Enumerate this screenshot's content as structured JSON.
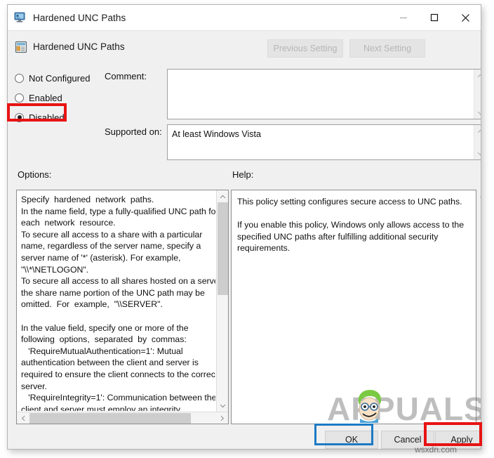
{
  "window": {
    "title": "Hardened UNC Paths",
    "title_icon": "monitor-icon",
    "minimize_label": "—",
    "maximize_label": "□",
    "close_label": "✕"
  },
  "header": {
    "icon": "policy-setting-icon",
    "title": "Hardened UNC Paths",
    "previous_setting_label": "Previous Setting",
    "next_setting_label": "Next Setting"
  },
  "state": {
    "options": [
      {
        "label": "Not Configured",
        "selected": false
      },
      {
        "label": "Enabled",
        "selected": false
      },
      {
        "label": "Disabled",
        "selected": true
      }
    ],
    "selected_value": "Disabled"
  },
  "comment": {
    "label": "Comment:",
    "value": ""
  },
  "supported_on": {
    "label": "Supported on:",
    "value": "At least Windows Vista"
  },
  "options_panel": {
    "label": "Options:",
    "text": "Specify  hardened  network  paths.\nIn the name field, type a fully-qualified UNC path for\neach  network  resource.\nTo secure all access to a share with a particular\nname, regardless of the server name, specify a\nserver name of '*' (asterisk). For example,\n\"\\\\*\\NETLOGON\".\nTo secure all access to all shares hosted on a server,\nthe share name portion of the UNC path may be\nomitted.  For  example,  \"\\\\SERVER\".\n\nIn the value field, specify one or more of the\nfollowing  options,  separated  by  commas:\n   'RequireMutualAuthentication=1': Mutual\nauthentication between the client and server is\nrequired to ensure the client connects to the correct\nserver.\n   'RequireIntegrity=1': Communication between the\nclient and server must employ an integrity"
  },
  "help_panel": {
    "label": "Help:",
    "text": "This policy setting configures secure access to UNC paths.\n\nIf you enable this policy, Windows only allows access to the specified UNC paths after fulfilling additional security requirements."
  },
  "footer": {
    "ok_label": "OK",
    "cancel_label": "Cancel",
    "apply_label": "Apply"
  },
  "annotations": {
    "highlight_color_red": "#e81313",
    "highlight_color_blue": "#1d7ac4",
    "red_targets": [
      "Disabled",
      "Apply"
    ],
    "blue_targets": [
      "OK"
    ]
  },
  "watermarks": {
    "brand": "APPUALS",
    "source": "wsxdn.com"
  }
}
